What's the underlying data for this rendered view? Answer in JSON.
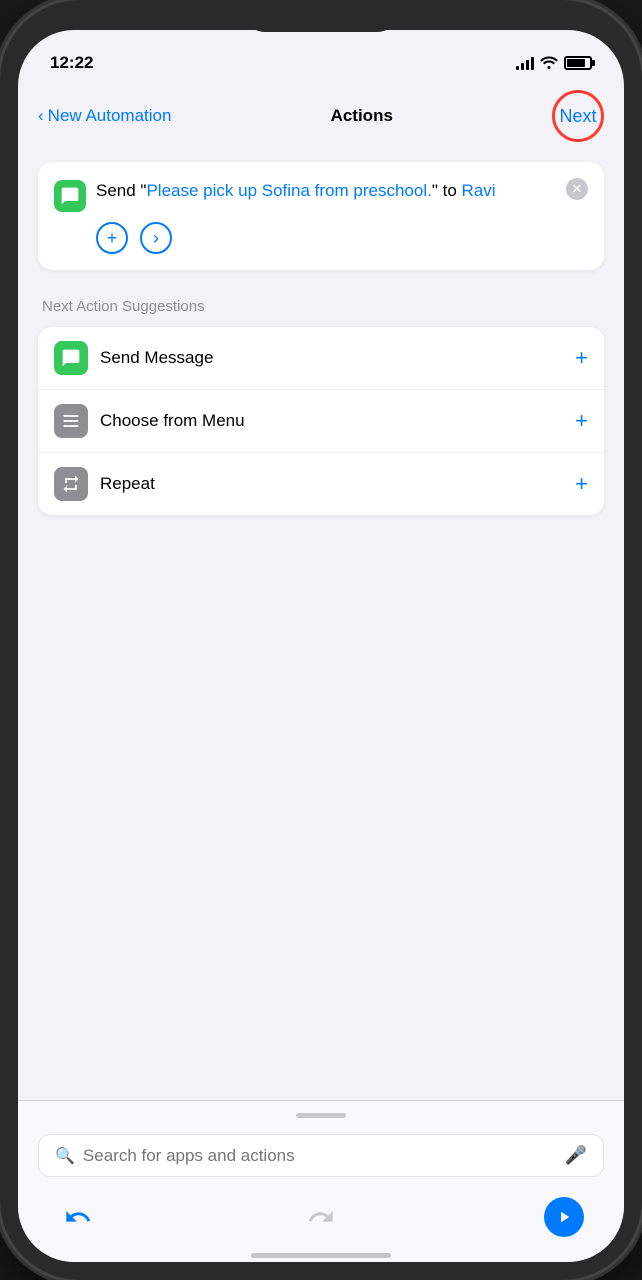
{
  "statusBar": {
    "time": "12:22",
    "signal": "signal"
  },
  "navBar": {
    "backLabel": "New Automation",
    "title": "Actions",
    "nextLabel": "Next"
  },
  "actionCard": {
    "sendLabel": "Send",
    "openQuote": "“",
    "messageText": "Please pick up Sofina from preschool.",
    "closeQuote": "”",
    "toLabel": "to",
    "recipientLabel": "Ravi",
    "addBtnLabel": "+",
    "detailBtnLabel": "›"
  },
  "suggestions": {
    "sectionTitle": "Next Action Suggestions",
    "items": [
      {
        "id": "send-message",
        "label": "Send Message",
        "iconType": "green",
        "iconChar": "💬"
      },
      {
        "id": "choose-from-menu",
        "label": "Choose from Menu",
        "iconType": "gray",
        "iconChar": "☰"
      },
      {
        "id": "repeat",
        "label": "Repeat",
        "iconType": "gray",
        "iconChar": "↻"
      }
    ],
    "addIcon": "+"
  },
  "searchBar": {
    "placeholder": "Search for apps and actions"
  },
  "toolbar": {
    "undoLabel": "undo",
    "redoLabel": "redo",
    "playLabel": "play"
  }
}
